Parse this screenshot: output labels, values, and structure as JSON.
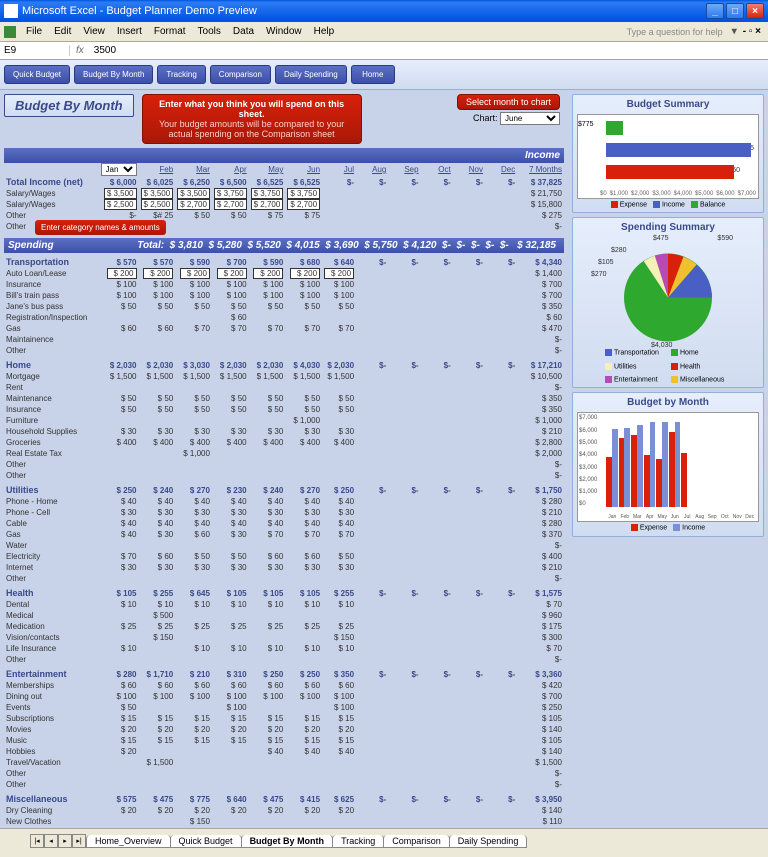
{
  "window": {
    "title": "Microsoft Excel - Budget Planner Demo Preview"
  },
  "menu": [
    "File",
    "Edit",
    "View",
    "Insert",
    "Format",
    "Tools",
    "Data",
    "Window",
    "Help"
  ],
  "help_prompt": "Type a question for help",
  "formula": {
    "cell": "E9",
    "fx": "fx",
    "value": "3500"
  },
  "toolbar": [
    "Quick Budget",
    "Budget By Month",
    "Tracking",
    "Comparison",
    "Daily Spending",
    "Home"
  ],
  "sheet_title": "Budget By Month",
  "tip": {
    "t1": "Enter what you think you will spend on this sheet.",
    "t2": "Your budget amounts will be compared to your actual spending on the Comparison sheet"
  },
  "chart_select": {
    "label": "Select month to chart",
    "field": "Chart:",
    "value": "June"
  },
  "callout1": "Enter category names & amounts",
  "months": [
    "Jan",
    "Feb",
    "Mar",
    "Apr",
    "May",
    "Jun",
    "Jul",
    "Aug",
    "Sep",
    "Oct",
    "Nov",
    "Dec"
  ],
  "total_col": "7 Months",
  "income": {
    "header": "Income",
    "total_label": "Total Income (net)",
    "total_vals": [
      "$ 6,000",
      "$ 6,025",
      "$ 6,250",
      "$ 6,500",
      "$ 6,525",
      "$ 6,525",
      "$-",
      "$-",
      "$-",
      "$-",
      "$-",
      "$-"
    ],
    "total_sum": "$ 37,825",
    "rows": [
      {
        "n": "Salary/Wages",
        "v": [
          "$ 3,500",
          "$ 3,500",
          "$ 3,500",
          "$ 3,750",
          "$ 3,750",
          "$ 3,750"
        ],
        "t": "$ 21,750"
      },
      {
        "n": "Salary/Wages",
        "v": [
          "$ 2,500",
          "$ 2,500",
          "$ 2,700",
          "$ 2,700",
          "$ 2,700",
          "$ 2,700"
        ],
        "t": "$ 15,800"
      },
      {
        "n": "Other",
        "v": [
          "$-",
          "$# 25",
          "$ 50",
          "$ 50",
          "$ 75",
          "$ 75"
        ],
        "t": "$ 275"
      },
      {
        "n": "Other",
        "v": [
          "",
          "",
          "",
          "",
          "",
          ""
        ],
        "t": "$-"
      }
    ]
  },
  "spending": {
    "header": "Spending",
    "total_label": "Total:",
    "total_vals": [
      "$ 3,810",
      "$ 5,280",
      "$ 5,520",
      "$ 4,015",
      "$ 3,690",
      "$ 5,750",
      "$ 4,120",
      "$-",
      "$-",
      "$-",
      "$-",
      "$-"
    ],
    "total_sum": "$ 32,185"
  },
  "cats": [
    {
      "name": "Transportation",
      "tot": [
        "$ 570",
        "$ 570",
        "$ 590",
        "$ 700",
        "$ 590",
        "$ 680",
        "$ 640",
        "$-",
        "$-",
        "$-",
        "$-",
        "$-"
      ],
      "sum": "$ 4,340",
      "rows": [
        {
          "n": "Auto Loan/Lease",
          "v": [
            "$ 200",
            "$ 200",
            "$ 200",
            "$ 200",
            "$ 200",
            "$ 200",
            "$ 200"
          ],
          "t": "$ 1,400"
        },
        {
          "n": "Insurance",
          "v": [
            "$ 100",
            "$ 100",
            "$ 100",
            "$ 100",
            "$ 100",
            "$ 100",
            "$ 100"
          ],
          "t": "$ 700"
        },
        {
          "n": "Bill's train pass",
          "v": [
            "$ 100",
            "$ 100",
            "$ 100",
            "$ 100",
            "$ 100",
            "$ 100",
            "$ 100"
          ],
          "t": "$ 700"
        },
        {
          "n": "Jane's bus pass",
          "v": [
            "$ 50",
            "$ 50",
            "$ 50",
            "$ 50",
            "$ 50",
            "$ 50",
            "$ 50"
          ],
          "t": "$ 350"
        },
        {
          "n": "Registration/Inspection",
          "v": [
            "",
            "",
            "",
            "$ 60",
            "",
            "",
            ""
          ],
          "t": "$ 60"
        },
        {
          "n": "Gas",
          "v": [
            "$ 60",
            "$ 60",
            "$ 70",
            "$ 70",
            "$ 70",
            "$ 70",
            "$ 70"
          ],
          "t": "$ 470"
        },
        {
          "n": "Maintainence",
          "v": [
            "",
            "",
            "",
            "",
            "",
            "",
            ""
          ],
          "t": "$-"
        },
        {
          "n": "Other",
          "v": [
            "",
            "",
            "",
            "",
            "",
            "",
            ""
          ],
          "t": "$-"
        }
      ]
    },
    {
      "name": "Home",
      "tot": [
        "$ 2,030",
        "$ 2,030",
        "$ 3,030",
        "$ 2,030",
        "$ 2,030",
        "$ 4,030",
        "$ 2,030",
        "$-",
        "$-",
        "$-",
        "$-",
        "$-"
      ],
      "sum": "$ 17,210",
      "rows": [
        {
          "n": "Mortgage",
          "v": [
            "$ 1,500",
            "$ 1,500",
            "$ 1,500",
            "$ 1,500",
            "$ 1,500",
            "$ 1,500",
            "$ 1,500"
          ],
          "t": "$ 10,500"
        },
        {
          "n": "Rent",
          "v": [
            "",
            "",
            "",
            "",
            "",
            "",
            ""
          ],
          "t": "$-"
        },
        {
          "n": "Maintenance",
          "v": [
            "$ 50",
            "$ 50",
            "$ 50",
            "$ 50",
            "$ 50",
            "$ 50",
            "$ 50"
          ],
          "t": "$ 350"
        },
        {
          "n": "Insurance",
          "v": [
            "$ 50",
            "$ 50",
            "$ 50",
            "$ 50",
            "$ 50",
            "$ 50",
            "$ 50"
          ],
          "t": "$ 350"
        },
        {
          "n": "Furniture",
          "v": [
            "",
            "",
            "",
            "",
            "",
            "$ 1,000",
            ""
          ],
          "t": "$ 1,000"
        },
        {
          "n": "Household Supplies",
          "v": [
            "$ 30",
            "$ 30",
            "$ 30",
            "$ 30",
            "$ 30",
            "$ 30",
            "$ 30"
          ],
          "t": "$ 210"
        },
        {
          "n": "Groceries",
          "v": [
            "$ 400",
            "$ 400",
            "$ 400",
            "$ 400",
            "$ 400",
            "$ 400",
            "$ 400"
          ],
          "t": "$ 2,800"
        },
        {
          "n": "Real Estate Tax",
          "v": [
            "",
            "",
            "$ 1,000",
            "",
            "",
            "",
            ""
          ],
          "t": "$ 2,000"
        },
        {
          "n": "Other",
          "v": [
            "",
            "",
            "",
            "",
            "",
            "",
            ""
          ],
          "t": "$-"
        },
        {
          "n": "Other",
          "v": [
            "",
            "",
            "",
            "",
            "",
            "",
            ""
          ],
          "t": "$-"
        }
      ]
    },
    {
      "name": "Utilities",
      "tot": [
        "$ 250",
        "$ 240",
        "$ 270",
        "$ 230",
        "$ 240",
        "$ 270",
        "$ 250",
        "$-",
        "$-",
        "$-",
        "$-",
        "$-"
      ],
      "sum": "$ 1,750",
      "rows": [
        {
          "n": "Phone - Home",
          "v": [
            "$ 40",
            "$ 40",
            "$ 40",
            "$ 40",
            "$ 40",
            "$ 40",
            "$ 40"
          ],
          "t": "$ 280"
        },
        {
          "n": "Phone - Cell",
          "v": [
            "$ 30",
            "$ 30",
            "$ 30",
            "$ 30",
            "$ 30",
            "$ 30",
            "$ 30"
          ],
          "t": "$ 210"
        },
        {
          "n": "Cable",
          "v": [
            "$ 40",
            "$ 40",
            "$ 40",
            "$ 40",
            "$ 40",
            "$ 40",
            "$ 40"
          ],
          "t": "$ 280"
        },
        {
          "n": "Gas",
          "v": [
            "$ 40",
            "$ 30",
            "$ 60",
            "$ 30",
            "$ 70",
            "$ 70",
            "$ 70"
          ],
          "t": "$ 370"
        },
        {
          "n": "Water",
          "v": [
            "",
            "",
            "",
            "",
            "",
            "",
            ""
          ],
          "t": "$-"
        },
        {
          "n": "Electricity",
          "v": [
            "$ 70",
            "$ 60",
            "$ 50",
            "$ 50",
            "$ 60",
            "$ 60",
            "$ 50"
          ],
          "t": "$ 400"
        },
        {
          "n": "Internet",
          "v": [
            "$ 30",
            "$ 30",
            "$ 30",
            "$ 30",
            "$ 30",
            "$ 30",
            "$ 30"
          ],
          "t": "$ 210"
        },
        {
          "n": "Other",
          "v": [
            "",
            "",
            "",
            "",
            "",
            "",
            ""
          ],
          "t": "$-"
        }
      ]
    },
    {
      "name": "Health",
      "tot": [
        "$ 105",
        "$ 255",
        "$ 645",
        "$ 105",
        "$ 105",
        "$ 105",
        "$ 255",
        "$-",
        "$-",
        "$-",
        "$-",
        "$-"
      ],
      "sum": "$ 1,575",
      "rows": [
        {
          "n": "Dental",
          "v": [
            "$ 10",
            "$ 10",
            "$ 10",
            "$ 10",
            "$ 10",
            "$ 10",
            "$ 10"
          ],
          "t": "$ 70"
        },
        {
          "n": "Medical",
          "v": [
            "",
            "$ 500",
            "",
            "",
            "",
            "",
            ""
          ],
          "t": "$ 960"
        },
        {
          "n": "Medication",
          "v": [
            "$ 25",
            "$ 25",
            "$ 25",
            "$ 25",
            "$ 25",
            "$ 25",
            "$ 25"
          ],
          "t": "$ 175"
        },
        {
          "n": "Vision/contacts",
          "v": [
            "",
            "$ 150",
            "",
            "",
            "",
            "",
            "$ 150"
          ],
          "t": "$ 300"
        },
        {
          "n": "Life Insurance",
          "v": [
            "$ 10",
            "",
            "$ 10",
            "$ 10",
            "$ 10",
            "$ 10",
            "$ 10"
          ],
          "t": "$ 70"
        },
        {
          "n": "Other",
          "v": [
            "",
            "",
            "",
            "",
            "",
            "",
            ""
          ],
          "t": "$-"
        }
      ]
    },
    {
      "name": "Entertainment",
      "tot": [
        "$ 280",
        "$ 1,710",
        "$ 210",
        "$ 310",
        "$ 250",
        "$ 250",
        "$ 350",
        "$-",
        "$-",
        "$-",
        "$-",
        "$-"
      ],
      "sum": "$ 3,360",
      "rows": [
        {
          "n": "Memberships",
          "v": [
            "$ 60",
            "$ 60",
            "$ 60",
            "$ 60",
            "$ 60",
            "$ 60",
            "$ 60"
          ],
          "t": "$ 420"
        },
        {
          "n": "Dining out",
          "v": [
            "$ 100",
            "$ 100",
            "$ 100",
            "$ 100",
            "$ 100",
            "$ 100",
            "$ 100"
          ],
          "t": "$ 700"
        },
        {
          "n": "Events",
          "v": [
            "$ 50",
            "",
            "",
            "$ 100",
            "",
            "",
            "$ 100"
          ],
          "t": "$ 250"
        },
        {
          "n": "Subscriptions",
          "v": [
            "$ 15",
            "$ 15",
            "$ 15",
            "$ 15",
            "$ 15",
            "$ 15",
            "$ 15"
          ],
          "t": "$ 105"
        },
        {
          "n": "Movies",
          "v": [
            "$ 20",
            "$ 20",
            "$ 20",
            "$ 20",
            "$ 20",
            "$ 20",
            "$ 20"
          ],
          "t": "$ 140"
        },
        {
          "n": "Music",
          "v": [
            "$ 15",
            "$ 15",
            "$ 15",
            "$ 15",
            "$ 15",
            "$ 15",
            "$ 15"
          ],
          "t": "$ 105"
        },
        {
          "n": "Hobbies",
          "v": [
            "$ 20",
            "",
            "",
            "",
            "$ 40",
            "$ 40",
            "$ 40"
          ],
          "t": "$ 140"
        },
        {
          "n": "Travel/Vacation",
          "v": [
            "",
            "$ 1,500",
            "",
            "",
            "",
            "",
            ""
          ],
          "t": "$ 1,500"
        },
        {
          "n": "Other",
          "v": [
            "",
            "",
            "",
            "",
            "",
            "",
            ""
          ],
          "t": "$-"
        },
        {
          "n": "Other",
          "v": [
            "",
            "",
            "",
            "",
            "",
            "",
            ""
          ],
          "t": "$-"
        }
      ]
    },
    {
      "name": "Miscellaneous",
      "tot": [
        "$ 575",
        "$ 475",
        "$ 775",
        "$ 640",
        "$ 475",
        "$ 415",
        "$ 625",
        "$-",
        "$-",
        "$-",
        "$-",
        "$-"
      ],
      "sum": "$ 3,950",
      "rows": [
        {
          "n": "Dry Cleaning",
          "v": [
            "$ 20",
            "$ 20",
            "$ 20",
            "$ 20",
            "$ 20",
            "$ 20",
            "$ 20"
          ],
          "t": "$ 140"
        },
        {
          "n": "New Clothes",
          "v": [
            "",
            "",
            "$ 150",
            "",
            "",
            "",
            ""
          ],
          "t": "$ 110"
        },
        {
          "n": "Donations",
          "v": [
            "",
            "",
            "",
            "",
            "",
            "",
            ""
          ],
          "t": "$-"
        },
        {
          "n": "Child Care",
          "v": [
            "",
            "",
            "",
            "",
            "",
            "",
            ""
          ],
          "t": "$-"
        }
      ]
    }
  ],
  "budget_summary": {
    "title": "Budget Summary",
    "balance": "$775",
    "income": "$6,525",
    "expense": "$5,750",
    "xticks": [
      "$0",
      "$1,000",
      "$2,000",
      "$3,000",
      "$4,000",
      "$5,000",
      "$6,000",
      "$7,000"
    ],
    "legend": [
      "Expense",
      "Income",
      "Balance"
    ]
  },
  "spending_summary": {
    "title": "Spending Summary",
    "legend": [
      "Transportation",
      "Home",
      "Utilities",
      "Health",
      "Entertainment",
      "Miscellaneous"
    ],
    "labels": [
      "$590",
      "$475",
      "$280",
      "$105",
      "$270",
      "$4,030"
    ]
  },
  "budget_month": {
    "title": "Budget by Month",
    "yticks": [
      "$7,000",
      "$6,000",
      "$5,000",
      "$4,000",
      "$3,000",
      "$2,000",
      "$1,000",
      "$0"
    ],
    "legend": [
      "Expense",
      "Income"
    ]
  },
  "tabs": [
    "Home_Overview",
    "Quick Budget",
    "Budget By Month",
    "Tracking",
    "Comparison",
    "Daily Spending"
  ],
  "active_tab": 2,
  "chart_data": [
    {
      "type": "bar",
      "orientation": "horizontal",
      "title": "Budget Summary",
      "series": [
        {
          "name": "Balance",
          "values": [
            775
          ],
          "color": "#2fa82f"
        },
        {
          "name": "Income",
          "values": [
            6525
          ],
          "color": "#4a5fc4"
        },
        {
          "name": "Expense",
          "values": [
            5750
          ],
          "color": "#d9200a"
        }
      ],
      "xlim": [
        0,
        7000
      ]
    },
    {
      "type": "pie",
      "title": "Spending Summary",
      "categories": [
        "Transportation",
        "Home",
        "Utilities",
        "Health",
        "Entertainment",
        "Miscellaneous"
      ],
      "values": [
        590,
        4030,
        270,
        105,
        280,
        475
      ],
      "colors": [
        "#4a5fc4",
        "#2fa82f",
        "#f5f0b8",
        "#d9200a",
        "#b84ab8",
        "#f0c030"
      ]
    },
    {
      "type": "bar",
      "title": "Budget by Month",
      "categories": [
        "Jan",
        "Feb",
        "Mar",
        "Apr",
        "May",
        "Jun",
        "Jul",
        "Aug",
        "Sep",
        "Oct",
        "Nov",
        "Dec"
      ],
      "series": [
        {
          "name": "Expense",
          "values": [
            3810,
            5280,
            5520,
            4015,
            3690,
            5750,
            4120,
            0,
            0,
            0,
            0,
            0
          ],
          "color": "#d9200a"
        },
        {
          "name": "Income",
          "values": [
            6000,
            6025,
            6250,
            6500,
            6525,
            6525,
            0,
            0,
            0,
            0,
            0,
            0
          ],
          "color": "#7a8fd4"
        }
      ],
      "ylim": [
        0,
        7000
      ]
    }
  ]
}
